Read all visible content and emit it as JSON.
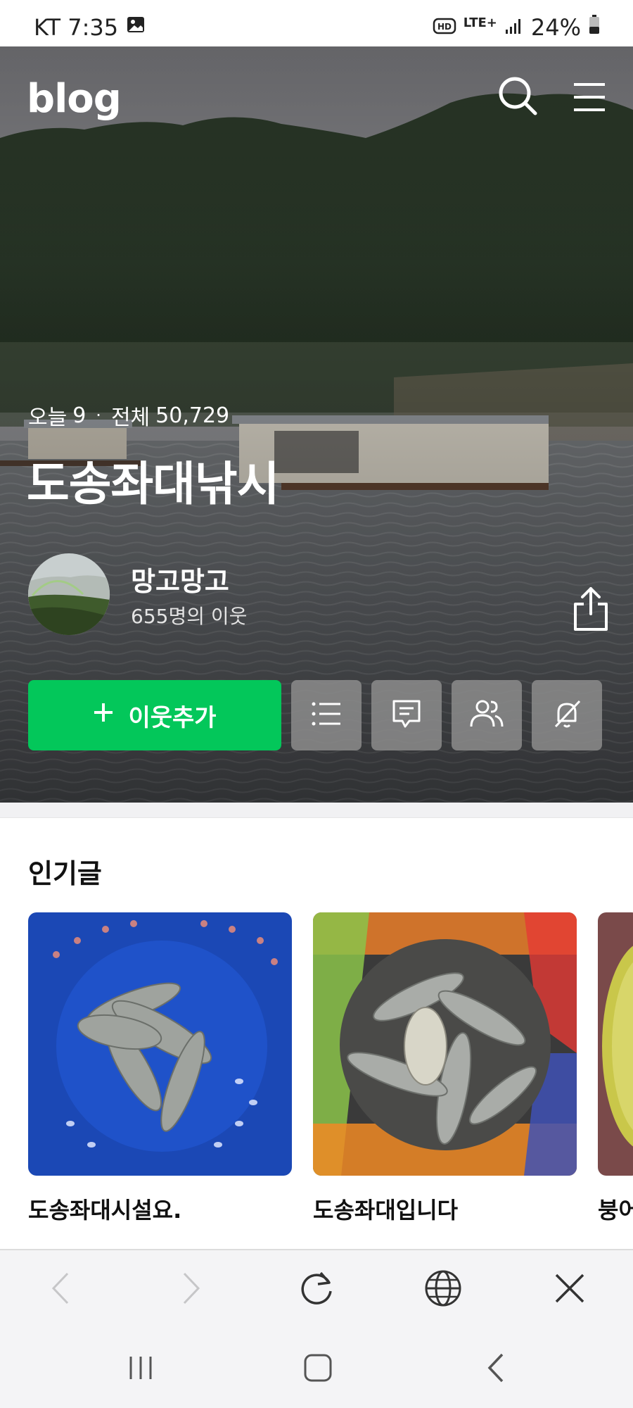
{
  "status_bar": {
    "carrier_time": "KT 7:35",
    "network": "LTE+",
    "battery": "24%",
    "icons": [
      "gallery-icon",
      "hd-icon",
      "lte-icon",
      "signal-icon",
      "battery-icon"
    ]
  },
  "header": {
    "logo": "blog",
    "icons": [
      "search-icon",
      "menu-icon"
    ]
  },
  "stats": {
    "today_label": "오늘",
    "today_count": "9",
    "separator": "·",
    "total_label": "전체",
    "total_count": "50,729"
  },
  "blog": {
    "title": "도송좌대낚시",
    "nickname": "망고망고",
    "neighbors": "655명의 이웃"
  },
  "actions": {
    "add_neighbor": "이웃추가",
    "icons": [
      "list-icon",
      "chat-icon",
      "people-icon",
      "no-notify-icon"
    ]
  },
  "popular": {
    "title": "인기글",
    "posts": [
      {
        "caption": "도송좌대시설요."
      },
      {
        "caption": "도송좌대입니다"
      },
      {
        "caption": "붕어"
      }
    ]
  },
  "toolbar": {
    "icons": [
      "back-icon",
      "forward-icon",
      "refresh-icon",
      "globe-icon",
      "close-icon"
    ]
  },
  "navbar": {
    "icons": [
      "recent-apps-icon",
      "home-icon",
      "nav-back-icon"
    ]
  },
  "colors": {
    "accent": "#03c75a",
    "toolbar_bg": "#f4f4f6"
  }
}
